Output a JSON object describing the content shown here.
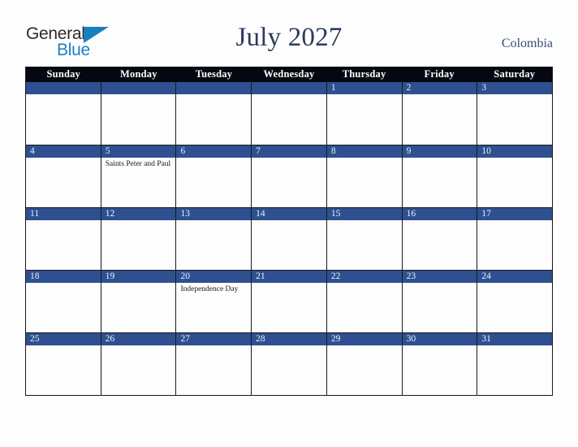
{
  "brand": {
    "word_one": "General",
    "word_two": "Blue",
    "triangle_icon": "triangle-icon",
    "color_dark": "#2b2b2b",
    "color_blue": "#1a7fc1"
  },
  "header": {
    "title": "July 2027",
    "country": "Colombia",
    "title_color": "#2b3a5c",
    "country_color": "#3b4d74"
  },
  "calendar": {
    "day_headers": [
      "Sunday",
      "Monday",
      "Tuesday",
      "Wednesday",
      "Thursday",
      "Friday",
      "Saturday"
    ],
    "header_bg": "#050810",
    "band_bg": "#2e5090",
    "cell_bg": "#fdfdfe",
    "grid_line": "#1a1a1a",
    "weeks": [
      [
        {
          "day": "",
          "events": []
        },
        {
          "day": "",
          "events": []
        },
        {
          "day": "",
          "events": []
        },
        {
          "day": "",
          "events": []
        },
        {
          "day": "1",
          "events": []
        },
        {
          "day": "2",
          "events": []
        },
        {
          "day": "3",
          "events": []
        }
      ],
      [
        {
          "day": "4",
          "events": []
        },
        {
          "day": "5",
          "events": [
            "Saints Peter and Paul"
          ]
        },
        {
          "day": "6",
          "events": []
        },
        {
          "day": "7",
          "events": []
        },
        {
          "day": "8",
          "events": []
        },
        {
          "day": "9",
          "events": []
        },
        {
          "day": "10",
          "events": []
        }
      ],
      [
        {
          "day": "11",
          "events": []
        },
        {
          "day": "12",
          "events": []
        },
        {
          "day": "13",
          "events": []
        },
        {
          "day": "14",
          "events": []
        },
        {
          "day": "15",
          "events": []
        },
        {
          "day": "16",
          "events": []
        },
        {
          "day": "17",
          "events": []
        }
      ],
      [
        {
          "day": "18",
          "events": []
        },
        {
          "day": "19",
          "events": []
        },
        {
          "day": "20",
          "events": [
            "Independence Day"
          ]
        },
        {
          "day": "21",
          "events": []
        },
        {
          "day": "22",
          "events": []
        },
        {
          "day": "23",
          "events": []
        },
        {
          "day": "24",
          "events": []
        }
      ],
      [
        {
          "day": "25",
          "events": []
        },
        {
          "day": "26",
          "events": []
        },
        {
          "day": "27",
          "events": []
        },
        {
          "day": "28",
          "events": []
        },
        {
          "day": "29",
          "events": []
        },
        {
          "day": "30",
          "events": []
        },
        {
          "day": "31",
          "events": []
        }
      ]
    ]
  }
}
